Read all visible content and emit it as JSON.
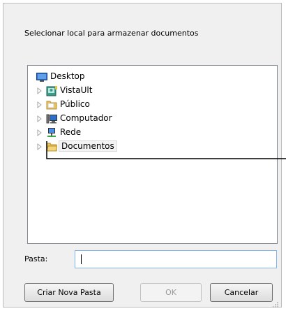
{
  "dialog": {
    "instruction": "Selecionar local para armazenar documentos",
    "tree": {
      "items": [
        {
          "label": "Desktop",
          "icon": "desktop-icon",
          "expandable": false
        },
        {
          "label": "VistaUlt",
          "icon": "user-folder-icon",
          "expandable": true
        },
        {
          "label": "Público",
          "icon": "folder-icon",
          "expandable": true
        },
        {
          "label": "Computador",
          "icon": "computer-icon",
          "expandable": true
        },
        {
          "label": "Rede",
          "icon": "network-icon",
          "expandable": true
        },
        {
          "label": "Documentos",
          "icon": "folder-icon",
          "expandable": true,
          "selected": true
        }
      ]
    },
    "folder_field": {
      "label": "Pasta:",
      "value": ""
    },
    "buttons": {
      "new_folder": "Criar Nova Pasta",
      "ok": "OK",
      "cancel": "Cancelar"
    }
  }
}
